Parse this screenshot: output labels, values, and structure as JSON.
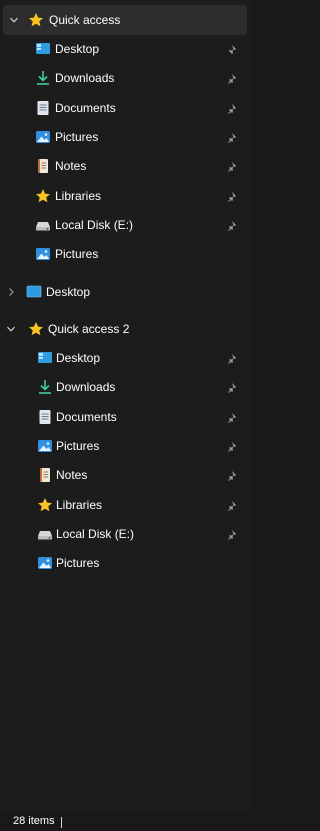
{
  "nav": {
    "groups": [
      {
        "label": "Quick access",
        "expanded": true,
        "icon": "star-icon",
        "items": [
          {
            "label": "Desktop",
            "icon": "desktop-icon",
            "pinned": true
          },
          {
            "label": "Downloads",
            "icon": "download-icon",
            "pinned": true
          },
          {
            "label": "Documents",
            "icon": "document-icon",
            "pinned": true
          },
          {
            "label": "Pictures",
            "icon": "pictures-icon",
            "pinned": true
          },
          {
            "label": "Notes",
            "icon": "notes-icon",
            "pinned": true
          },
          {
            "label": "Libraries",
            "icon": "star-icon",
            "pinned": true
          },
          {
            "label": "Local Disk (E:)",
            "icon": "drive-icon",
            "pinned": true
          },
          {
            "label": "Pictures",
            "icon": "pictures-icon",
            "pinned": false
          }
        ]
      },
      {
        "label": "Desktop",
        "expanded": false,
        "icon": "desktop-icon",
        "items": []
      },
      {
        "label": "Quick access 2",
        "expanded": true,
        "icon": "star-icon",
        "items": [
          {
            "label": "Desktop",
            "icon": "desktop-icon",
            "pinned": true
          },
          {
            "label": "Downloads",
            "icon": "download-icon",
            "pinned": true
          },
          {
            "label": "Documents",
            "icon": "document-icon",
            "pinned": true
          },
          {
            "label": "Pictures",
            "icon": "pictures-icon",
            "pinned": true
          },
          {
            "label": "Notes",
            "icon": "notes-icon",
            "pinned": true
          },
          {
            "label": "Libraries",
            "icon": "star-icon",
            "pinned": true
          },
          {
            "label": "Local Disk (E:)",
            "icon": "drive-icon",
            "pinned": true
          },
          {
            "label": "Pictures",
            "icon": "pictures-icon",
            "pinned": false
          }
        ]
      }
    ]
  },
  "status": {
    "items_count": "28 items"
  },
  "colors": {
    "background": "#1c1c1c",
    "selected": "#2d2d2d",
    "star": "#f7c325",
    "download": "#3fc9a5",
    "desktop": "#2f9be0",
    "pin": "#9a9a9a"
  }
}
